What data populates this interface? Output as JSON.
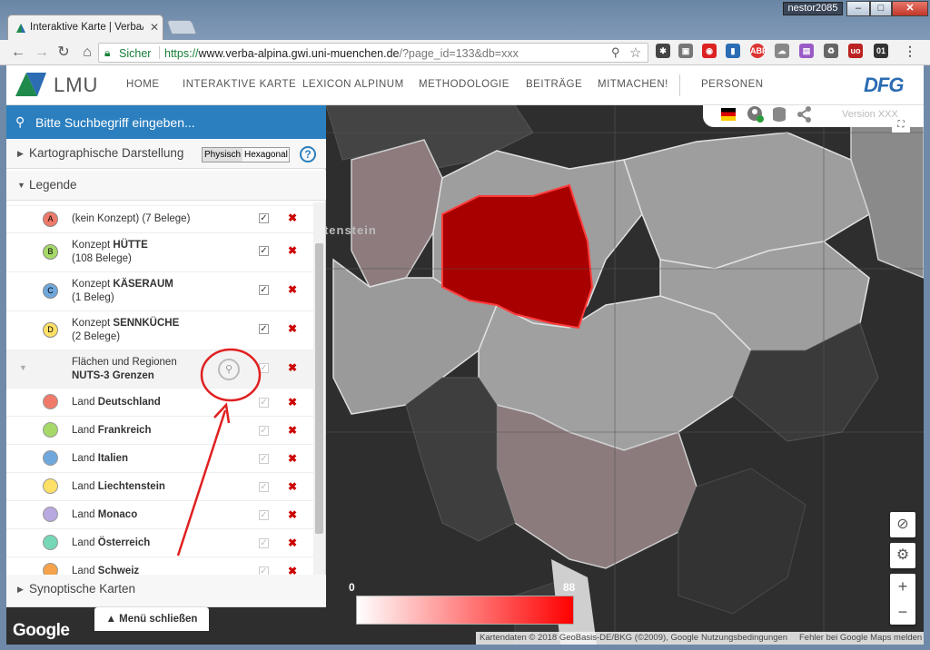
{
  "browser": {
    "tab_title": "Interaktive Karte | VerbaA",
    "user_badge": "nestor2085",
    "window_min": "–",
    "window_max": "□",
    "window_close": "✕",
    "secure_label": "Sicher",
    "url_proto": "https://",
    "url_host": "www.verba-alpina.gwi.uni-muenchen.de",
    "url_rest": "/?page_id=133&db=xxx"
  },
  "site": {
    "logo_text": "LMU",
    "nav": [
      "HOME",
      "INTERAKTIVE KARTE",
      "LEXICON ALPINUM",
      "METHODOLOGIE",
      "BEITRÄGE",
      "MITMACHEN!",
      "PERSONEN"
    ],
    "dfg": "DFG"
  },
  "sidebar": {
    "search_placeholder": "Bitte Suchbegriff eingeben...",
    "section_kart": "Kartographische Darstellung",
    "toggle_phys": "Physisch",
    "toggle_hex": "Hexagonal",
    "help": "?",
    "section_legende": "Legende",
    "section_synopt": "Synoptische Karten",
    "close_menu": "▲ Menü schließen",
    "legend": [
      {
        "letter": "A",
        "line1": "(kein Konzept) (7 Belege)",
        "line1_bold": "",
        "line2": "",
        "color": "#f07a6a"
      },
      {
        "letter": "B",
        "line1": "Konzept ",
        "line1_bold": "HÜTTE",
        "line2": "(108 Belege)",
        "color": "#a6d96a"
      },
      {
        "letter": "C",
        "line1": "Konzept ",
        "line1_bold": "KÄSERAUM",
        "line2": "(1 Beleg)",
        "color": "#6fa8dc"
      },
      {
        "letter": "D",
        "line1": "Konzept ",
        "line1_bold": "SENNKÜCHE",
        "line2": "(2 Belege)",
        "color": "#ffe066"
      }
    ],
    "group": {
      "line1": "Flächen und Regionen",
      "line2": "NUTS-3 Grenzen"
    },
    "countries": [
      {
        "prefix": "Land ",
        "name": "Deutschland",
        "color": "#f07a6a"
      },
      {
        "prefix": "Land ",
        "name": "Frankreich",
        "color": "#a6d96a"
      },
      {
        "prefix": "Land ",
        "name": "Italien",
        "color": "#6fa8dc"
      },
      {
        "prefix": "Land ",
        "name": "Liechtenstein",
        "color": "#ffe066"
      },
      {
        "prefix": "Land ",
        "name": "Monaco",
        "color": "#b9a9e0"
      },
      {
        "prefix": "Land ",
        "name": "Österreich",
        "color": "#76d7b6"
      },
      {
        "prefix": "Land ",
        "name": "Schweiz",
        "color": "#f6a24a"
      }
    ]
  },
  "map": {
    "version": "Version XXX",
    "place_label": "Liechtenstein",
    "scale_min": "0",
    "scale_max": "88",
    "google": "Google",
    "attrib_data": "Kartendaten © 2018 GeoBasis-DE/BKG (©2009), Google",
    "attrib_terms": "Nutzungsbedingungen",
    "attrib_report": "Fehler bei Google Maps melden",
    "zoom_in": "+",
    "zoom_out": "−"
  },
  "icons": [
    "search-icon",
    "help-icon",
    "flag-de-icon",
    "user-icon",
    "database-icon",
    "share-icon",
    "fullscreen-icon",
    "compass-icon",
    "gear-icon",
    "checkbox-icon",
    "delete-icon",
    "annotation-circle-icon",
    "annotation-arrow-icon"
  ]
}
